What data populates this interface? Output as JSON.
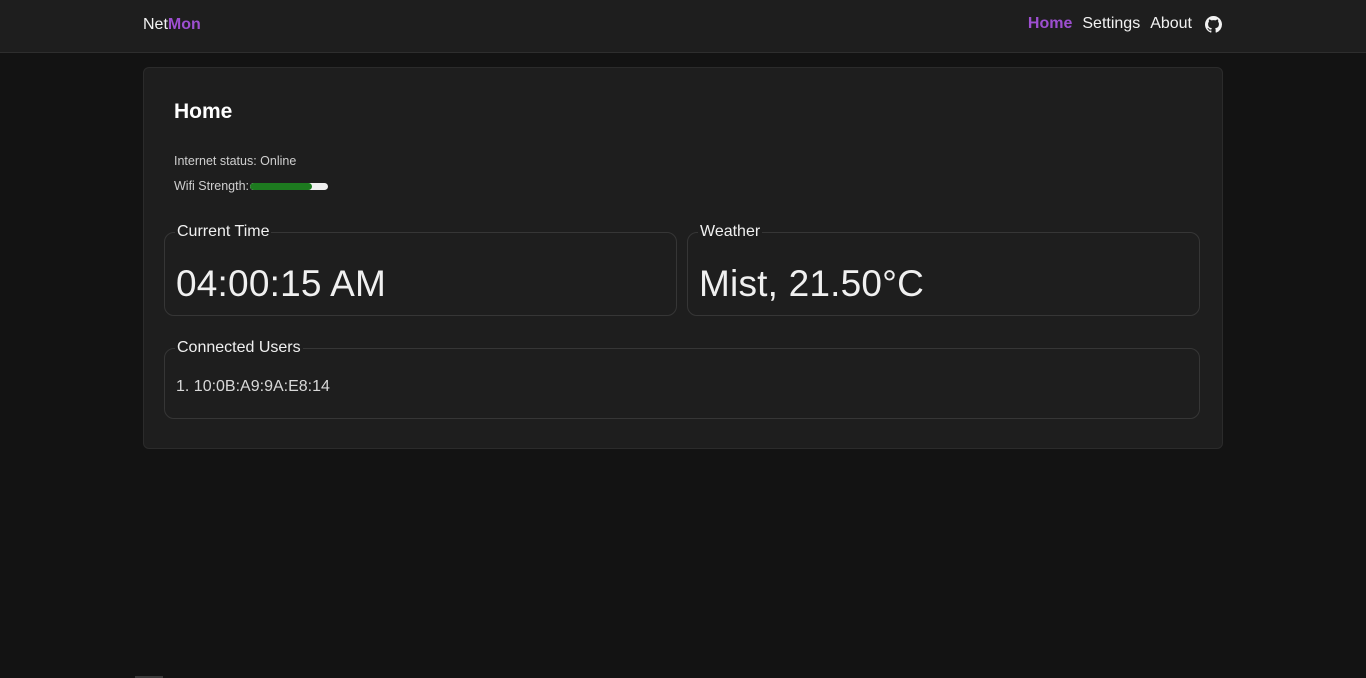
{
  "nav": {
    "brand_prefix": "Net",
    "brand_accent": "Mon",
    "links": [
      {
        "label": "Home",
        "active": true
      },
      {
        "label": "Settings",
        "active": false
      },
      {
        "label": "About",
        "active": false
      }
    ],
    "icon": "github-icon"
  },
  "home": {
    "title": "Home",
    "internet_status_label": "Internet status: Online",
    "wifi_label": "Wifi Strength:",
    "wifi_strength_fraction": 0.8
  },
  "time_panel": {
    "legend": "Current Time",
    "value": "04:00:15 AM"
  },
  "weather_panel": {
    "legend": "Weather",
    "value": "Mist, 21.50°C"
  },
  "users_panel": {
    "legend": "Connected Users",
    "items": [
      "1. 10:0B:A9:9A:E8:14"
    ]
  },
  "colors": {
    "accent": "#9d4fd0",
    "background": "#131313",
    "card": "#1e1e1e",
    "wifi_fill": "#1d7a1f"
  }
}
